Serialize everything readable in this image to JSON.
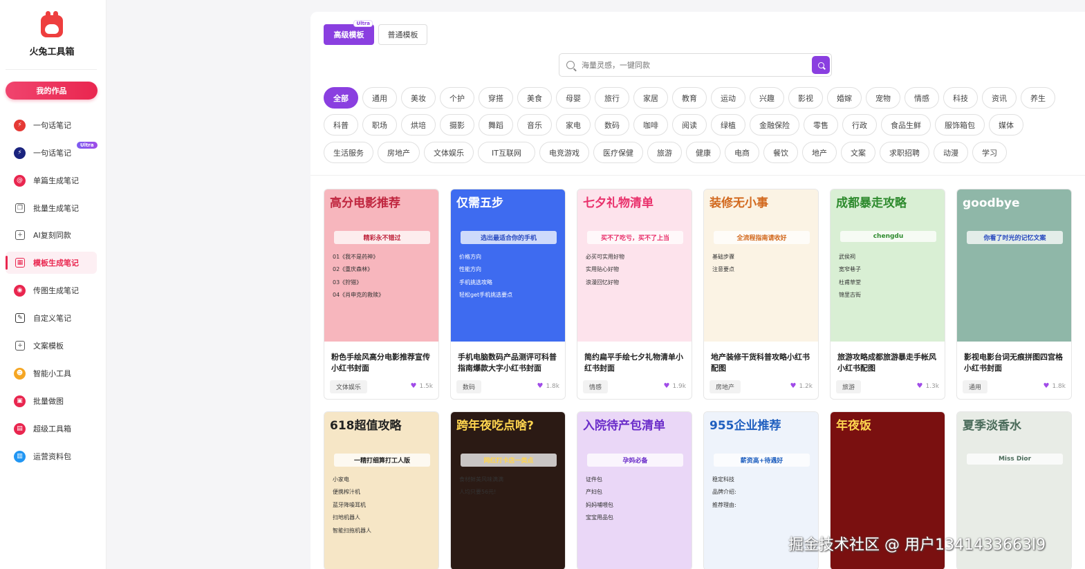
{
  "app": {
    "title": "火兔工具箱"
  },
  "sidebar": {
    "works_button": "我的作品",
    "items": [
      {
        "label": "一句话笔记",
        "icon": "bolt-icon",
        "color": "#e53935"
      },
      {
        "label": "一句话笔记",
        "icon": "bolt-icon",
        "color": "#1a237e",
        "badge": "Ultra"
      },
      {
        "label": "单篇生成笔记",
        "icon": "at-icon",
        "color": "#e9264f"
      },
      {
        "label": "批量生成笔记",
        "icon": "copy-icon",
        "color": "#555555"
      },
      {
        "label": "AI复刻同款",
        "icon": "plus-square-icon",
        "color": "#555555"
      },
      {
        "label": "模板生成笔记",
        "icon": "grid-icon",
        "color": "#e9264f"
      },
      {
        "label": "传图生成笔记",
        "icon": "camera-icon",
        "color": "#e9264f"
      },
      {
        "label": "自定义笔记",
        "icon": "pen-icon",
        "color": "#333333"
      },
      {
        "label": "文案模板",
        "icon": "plus-square-icon",
        "color": "#555555"
      },
      {
        "label": "智能小工具",
        "icon": "robot-icon",
        "color": "#f5a623"
      },
      {
        "label": "批量做图",
        "icon": "image-icon",
        "color": "#e9264f"
      },
      {
        "label": "超级工具箱",
        "icon": "toolbox-icon",
        "color": "#e9264f"
      },
      {
        "label": "运营资料包",
        "icon": "folder-icon",
        "color": "#2196f3"
      }
    ]
  },
  "tabs": {
    "advanced": "高级模板",
    "advanced_badge": "Ultra",
    "normal": "普通模板"
  },
  "search": {
    "placeholder": "海量灵感，一键同款"
  },
  "categories": [
    [
      "全部",
      "通用",
      "美妆",
      "个护",
      "穿搭",
      "美食",
      "母婴",
      "旅行",
      "家居",
      "教育",
      "运动",
      "兴趣",
      "影视",
      "婚嫁",
      "宠物",
      "情感",
      "科技",
      "资讯",
      "养生"
    ],
    [
      "科普",
      "职场",
      "烘培",
      "摄影",
      "舞蹈",
      "音乐",
      "家电",
      "数码",
      "咖啡",
      "阅读",
      "绿植",
      "金融保险",
      "零售",
      "行政",
      "食品生鲜",
      "服饰箱包",
      "媒体"
    ],
    [
      "生活服务",
      "房地产",
      "文体娱乐",
      "IT互联网",
      "电竞游戏",
      "医疗保健",
      "旅游",
      "健康",
      "电商",
      "餐饮",
      "地产",
      "文案",
      "求职招聘",
      "动漫",
      "学习"
    ]
  ],
  "cards": [
    {
      "title": "粉色手绘风高分电影推荐宣传小红书封面",
      "tag": "文体娱乐",
      "likes": "1.5k",
      "thumb": {
        "head": "高分电影推荐",
        "sub": "精彩永不错过",
        "lines": [
          "01《我不是药神》",
          "02《重庆森林》",
          "03《狩猎》",
          "04《肖申克的救赎》"
        ],
        "bg": "#f7b6bd",
        "fg": "#c0263f"
      }
    },
    {
      "title": "手机电脑数码产品测评可科普指南爆款大字小红书封面",
      "tag": "数码",
      "likes": "1.8k",
      "thumb": {
        "head": "仅需五步",
        "sub": "选出最适合你的手机",
        "lines": [
          "价格方向",
          "性能方向",
          "手机挑选攻略",
          "轻松get手机挑选要点"
        ],
        "bg": "#3e6bf0",
        "fg": "#ffffff"
      }
    },
    {
      "title": "简约扁平手绘七夕礼物清单小红书封面",
      "tag": "情感",
      "likes": "1.9k",
      "thumb": {
        "head": "七夕礼物清单",
        "sub": "买不了吃亏，买不了上当",
        "lines": [
          "必买可实用好物",
          "实用贴心好物",
          "浪漫回忆好物"
        ],
        "bg": "#fde3ec",
        "fg": "#e9306b"
      }
    },
    {
      "title": "地产装修干货科普攻略小红书配图",
      "tag": "房地产",
      "likes": "1.2k",
      "thumb": {
        "head": "装修无小事",
        "sub": "全流程指南请收好",
        "lines": [
          "基础步骤",
          "注意要点"
        ],
        "bg": "#fbf3e4",
        "fg": "#d2691e"
      }
    },
    {
      "title": "旅游攻略成都旅游暴走手帐风小红书配图",
      "tag": "旅游",
      "likes": "1.3k",
      "thumb": {
        "head": "成都暴走攻略",
        "sub": "chengdu",
        "lines": [
          "武侯祠",
          "宽窄巷子",
          "杜甫草堂",
          "锦里古街"
        ],
        "bg": "#d9efd4",
        "fg": "#2e8b2e"
      }
    },
    {
      "title": "影视电影台词无痕拼图四宫格小红书封面",
      "tag": "通用",
      "likes": "1.8k",
      "thumb": {
        "head": "goodbye",
        "sub": "你看了时光的记忆文案",
        "lines": [],
        "bg": "#8fb7a8",
        "fg": "#ffffff"
      }
    },
    {
      "title": "",
      "tag": "",
      "likes": "",
      "thumb": {
        "head": "618超值攻略",
        "sub": "一精打细算打工人版",
        "lines": [
          "小家电",
          "便携榨汁机",
          "蓝牙降噪耳机",
          "扫地机器人",
          "智能扫拖机器人"
        ],
        "bg": "#f6e6c6",
        "fg": "#222222"
      }
    },
    {
      "title": "",
      "tag": "",
      "likes": "",
      "thumb": {
        "head": "跨年夜吃点啥?",
        "sub": "网红打卡店一类点",
        "lines": [
          "食材鲜美风味满满",
          "人均只要56元!"
        ],
        "bg": "#2b1a14",
        "fg": "#ffd54f"
      }
    },
    {
      "title": "",
      "tag": "",
      "likes": "",
      "thumb": {
        "head": "入院待产包清单",
        "sub": "孕妈必备",
        "lines": [
          "证件包",
          "产妇包",
          "妈妈哺喂包",
          "宝宝用品包"
        ],
        "bg": "#ead7f7",
        "fg": "#6a2cc9"
      }
    },
    {
      "title": "",
      "tag": "",
      "likes": "",
      "thumb": {
        "head": "955企业推荐",
        "sub": "薪资高+待遇好",
        "lines": [
          "稳定科技",
          "品牌介绍:",
          "推荐理由:"
        ],
        "bg": "#eef3fb",
        "fg": "#1f5fbf"
      }
    },
    {
      "title": "",
      "tag": "",
      "likes": "",
      "thumb": {
        "head": "年夜饭",
        "sub": "",
        "lines": [],
        "bg": "#7a1010",
        "fg": "#ffd54f"
      }
    },
    {
      "title": "",
      "tag": "",
      "likes": "",
      "thumb": {
        "head": "夏季淡香水",
        "sub": "Miss Dior",
        "lines": [],
        "bg": "#e8ece6",
        "fg": "#4a6b5a"
      }
    }
  ],
  "watermark": "掘金技术社区 @ 用户1341433663l9",
  "colors": {
    "accent": "#8a3fe0",
    "brand": "#e9264f"
  }
}
